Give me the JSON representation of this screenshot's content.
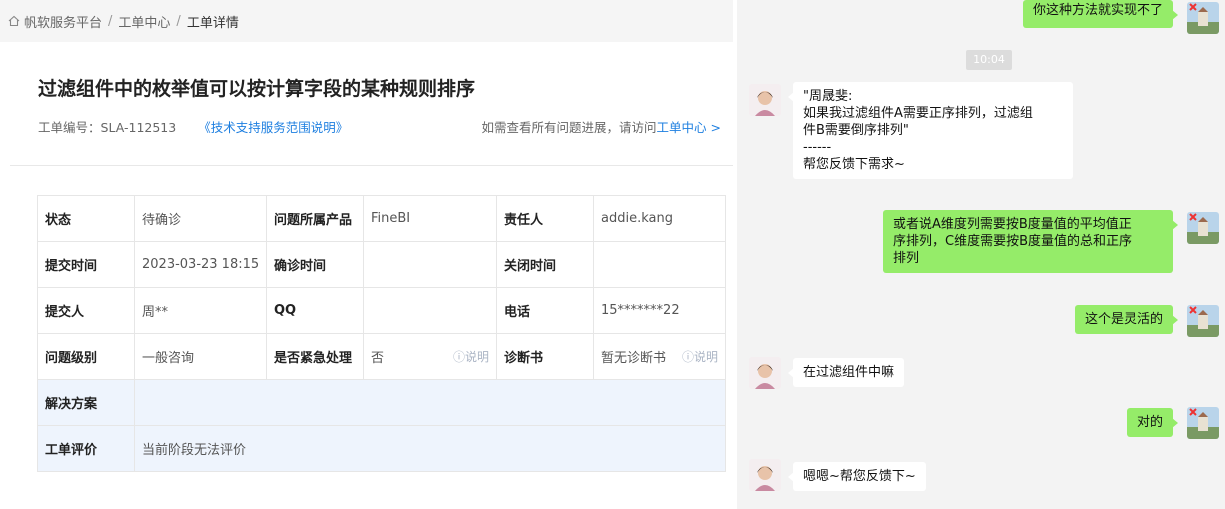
{
  "breadcrumb": {
    "home": "帆软服务平台",
    "middle": "工单中心",
    "current": "工单详情",
    "sep": "/"
  },
  "ticket": {
    "title": "过滤组件中的枚举值可以按计算字段的某种规则排序",
    "number_label": "工单编号：",
    "number": "SLA-112513",
    "scope_link": "《技术支持服务范围说明》",
    "right_prefix": "如需查看所有问题进展，请访问",
    "right_link": "工单中心 >"
  },
  "table": {
    "status_label": "状态",
    "status": "待确诊",
    "product_label": "问题所属产品",
    "product": "FineBI",
    "owner_label": "责任人",
    "owner": "addie.kang",
    "submit_time_label": "提交时间",
    "submit_time": "2023-03-23 18:15",
    "confirm_time_label": "确诊时间",
    "confirm_time": "",
    "close_time_label": "关闭时间",
    "close_time": "",
    "submitter_label": "提交人",
    "submitter": "周**",
    "qq_label": "QQ",
    "qq": "",
    "phone_label": "电话",
    "phone": "15*******22",
    "level_label": "问题级别",
    "level": "一般咨询",
    "urgent_label": "是否紧急处理",
    "urgent": "否",
    "explain": "ⓘ说明",
    "diag_label": "诊断书",
    "diag": "暂无诊断书",
    "solution_label": "解决方案",
    "solution": "",
    "rating_label": "工单评价",
    "rating": "当前阶段无法评价"
  },
  "chat": {
    "timestamp": "10:04",
    "messages": [
      {
        "from": "me",
        "text": "你这种方法就实现不了"
      },
      {
        "from": "them",
        "text": "\"周晟斐:\n如果我过滤组件A需要正序排列，过滤组\n件B需要倒序排列\"\n------\n帮您反馈下需求~"
      },
      {
        "from": "me",
        "text": "或者说A维度列需要按B度量值的平均值正\n序排列，C维度需要按B度量值的总和正序\n排列"
      },
      {
        "from": "me",
        "text": "这个是灵活的"
      },
      {
        "from": "them",
        "text": "在过滤组件中嘛"
      },
      {
        "from": "me",
        "text": "对的"
      },
      {
        "from": "them",
        "text": "嗯嗯~帮您反馈下~"
      }
    ]
  },
  "colors": {
    "accent": "#1e7fe0",
    "me_bubble": "#95ec69",
    "them_bubble": "#ffffff",
    "chat_bg": "#f3f3f3",
    "blue_row": "#eef4fd"
  }
}
